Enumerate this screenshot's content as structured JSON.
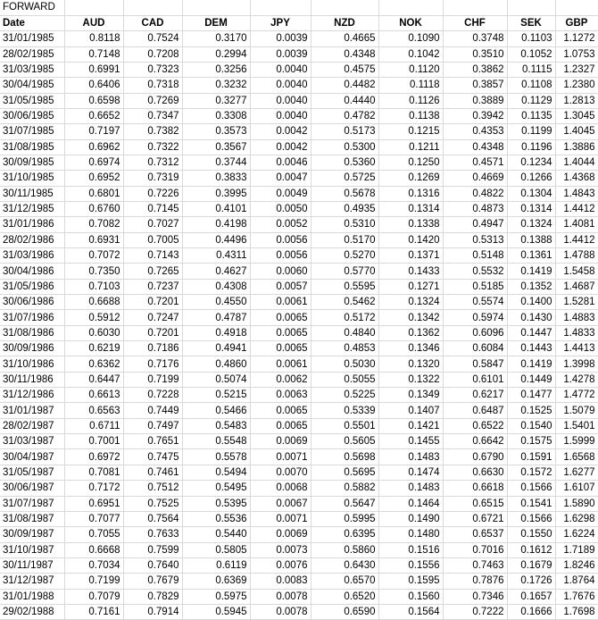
{
  "sheet": {
    "title_cell": "FORWARD",
    "headers": [
      "Date",
      "AUD",
      "CAD",
      "DEM",
      "JPY",
      "NZD",
      "NOK",
      "CHF",
      "SEK",
      "GBP"
    ],
    "rows": [
      [
        "31/01/1985",
        "0.8118",
        "0.7524",
        "0.3170",
        "0.0039",
        "0.4665",
        "0.1090",
        "0.3748",
        "0.1103",
        "1.1272"
      ],
      [
        "28/02/1985",
        "0.7148",
        "0.7208",
        "0.2994",
        "0.0039",
        "0.4348",
        "0.1042",
        "0.3510",
        "0.1052",
        "1.0753"
      ],
      [
        "31/03/1985",
        "0.6991",
        "0.7323",
        "0.3256",
        "0.0040",
        "0.4575",
        "0.1120",
        "0.3862",
        "0.1115",
        "1.2327"
      ],
      [
        "30/04/1985",
        "0.6406",
        "0.7318",
        "0.3232",
        "0.0040",
        "0.4482",
        "0.1118",
        "0.3857",
        "0.1108",
        "1.2380"
      ],
      [
        "31/05/1985",
        "0.6598",
        "0.7269",
        "0.3277",
        "0.0040",
        "0.4440",
        "0.1126",
        "0.3889",
        "0.1129",
        "1.2813"
      ],
      [
        "30/06/1985",
        "0.6652",
        "0.7347",
        "0.3308",
        "0.0040",
        "0.4782",
        "0.1138",
        "0.3942",
        "0.1135",
        "1.3045"
      ],
      [
        "31/07/1985",
        "0.7197",
        "0.7382",
        "0.3573",
        "0.0042",
        "0.5173",
        "0.1215",
        "0.4353",
        "0.1199",
        "1.4045"
      ],
      [
        "31/08/1985",
        "0.6962",
        "0.7322",
        "0.3567",
        "0.0042",
        "0.5300",
        "0.1211",
        "0.4348",
        "0.1196",
        "1.3886"
      ],
      [
        "30/09/1985",
        "0.6974",
        "0.7312",
        "0.3744",
        "0.0046",
        "0.5360",
        "0.1250",
        "0.4571",
        "0.1234",
        "1.4044"
      ],
      [
        "31/10/1985",
        "0.6952",
        "0.7319",
        "0.3833",
        "0.0047",
        "0.5725",
        "0.1269",
        "0.4669",
        "0.1266",
        "1.4368"
      ],
      [
        "30/11/1985",
        "0.6801",
        "0.7226",
        "0.3995",
        "0.0049",
        "0.5678",
        "0.1316",
        "0.4822",
        "0.1304",
        "1.4843"
      ],
      [
        "31/12/1985",
        "0.6760",
        "0.7145",
        "0.4101",
        "0.0050",
        "0.4935",
        "0.1314",
        "0.4873",
        "0.1314",
        "1.4412"
      ],
      [
        "31/01/1986",
        "0.7082",
        "0.7027",
        "0.4198",
        "0.0052",
        "0.5310",
        "0.1338",
        "0.4947",
        "0.1324",
        "1.4081"
      ],
      [
        "28/02/1986",
        "0.6931",
        "0.7005",
        "0.4496",
        "0.0056",
        "0.5170",
        "0.1420",
        "0.5313",
        "0.1388",
        "1.4412"
      ],
      [
        "31/03/1986",
        "0.7072",
        "0.7143",
        "0.4311",
        "0.0056",
        "0.5270",
        "0.1371",
        "0.5148",
        "0.1361",
        "1.4788"
      ],
      [
        "30/04/1986",
        "0.7350",
        "0.7265",
        "0.4627",
        "0.0060",
        "0.5770",
        "0.1433",
        "0.5532",
        "0.1419",
        "1.5458"
      ],
      [
        "31/05/1986",
        "0.7103",
        "0.7237",
        "0.4308",
        "0.0057",
        "0.5595",
        "0.1271",
        "0.5185",
        "0.1352",
        "1.4687"
      ],
      [
        "30/06/1986",
        "0.6688",
        "0.7201",
        "0.4550",
        "0.0061",
        "0.5462",
        "0.1324",
        "0.5574",
        "0.1400",
        "1.5281"
      ],
      [
        "31/07/1986",
        "0.5912",
        "0.7247",
        "0.4787",
        "0.0065",
        "0.5172",
        "0.1342",
        "0.5974",
        "0.1430",
        "1.4883"
      ],
      [
        "31/08/1986",
        "0.6030",
        "0.7201",
        "0.4918",
        "0.0065",
        "0.4840",
        "0.1362",
        "0.6096",
        "0.1447",
        "1.4833"
      ],
      [
        "30/09/1986",
        "0.6219",
        "0.7186",
        "0.4941",
        "0.0065",
        "0.4853",
        "0.1346",
        "0.6084",
        "0.1443",
        "1.4413"
      ],
      [
        "31/10/1986",
        "0.6362",
        "0.7176",
        "0.4860",
        "0.0061",
        "0.5030",
        "0.1320",
        "0.5847",
        "0.1419",
        "1.3998"
      ],
      [
        "30/11/1986",
        "0.6447",
        "0.7199",
        "0.5074",
        "0.0062",
        "0.5055",
        "0.1322",
        "0.6101",
        "0.1449",
        "1.4278"
      ],
      [
        "31/12/1986",
        "0.6613",
        "0.7228",
        "0.5215",
        "0.0063",
        "0.5225",
        "0.1349",
        "0.6217",
        "0.1477",
        "1.4772"
      ],
      [
        "31/01/1987",
        "0.6563",
        "0.7449",
        "0.5466",
        "0.0065",
        "0.5339",
        "0.1407",
        "0.6487",
        "0.1525",
        "1.5079"
      ],
      [
        "28/02/1987",
        "0.6711",
        "0.7497",
        "0.5483",
        "0.0065",
        "0.5501",
        "0.1421",
        "0.6522",
        "0.1540",
        "1.5401"
      ],
      [
        "31/03/1987",
        "0.7001",
        "0.7651",
        "0.5548",
        "0.0069",
        "0.5605",
        "0.1455",
        "0.6642",
        "0.1575",
        "1.5999"
      ],
      [
        "30/04/1987",
        "0.6972",
        "0.7475",
        "0.5578",
        "0.0071",
        "0.5698",
        "0.1483",
        "0.6790",
        "0.1591",
        "1.6568"
      ],
      [
        "31/05/1987",
        "0.7081",
        "0.7461",
        "0.5494",
        "0.0070",
        "0.5695",
        "0.1474",
        "0.6630",
        "0.1572",
        "1.6277"
      ],
      [
        "30/06/1987",
        "0.7172",
        "0.7512",
        "0.5495",
        "0.0068",
        "0.5882",
        "0.1483",
        "0.6618",
        "0.1566",
        "1.6107"
      ],
      [
        "31/07/1987",
        "0.6951",
        "0.7525",
        "0.5395",
        "0.0067",
        "0.5647",
        "0.1464",
        "0.6515",
        "0.1541",
        "1.5890"
      ],
      [
        "31/08/1987",
        "0.7077",
        "0.7564",
        "0.5536",
        "0.0071",
        "0.5995",
        "0.1490",
        "0.6721",
        "0.1566",
        "1.6298"
      ],
      [
        "30/09/1987",
        "0.7055",
        "0.7633",
        "0.5440",
        "0.0069",
        "0.6395",
        "0.1480",
        "0.6537",
        "0.1550",
        "1.6224"
      ],
      [
        "31/10/1987",
        "0.6668",
        "0.7599",
        "0.5805",
        "0.0073",
        "0.5860",
        "0.1516",
        "0.7016",
        "0.1612",
        "1.7189"
      ],
      [
        "30/11/1987",
        "0.7034",
        "0.7640",
        "0.6119",
        "0.0076",
        "0.6430",
        "0.1556",
        "0.7463",
        "0.1679",
        "1.8246"
      ],
      [
        "31/12/1987",
        "0.7199",
        "0.7679",
        "0.6369",
        "0.0083",
        "0.6570",
        "0.1595",
        "0.7876",
        "0.1726",
        "1.8764"
      ],
      [
        "31/01/1988",
        "0.7079",
        "0.7829",
        "0.5975",
        "0.0078",
        "0.6520",
        "0.1560",
        "0.7346",
        "0.1657",
        "1.7676"
      ],
      [
        "29/02/1988",
        "0.7161",
        "0.7914",
        "0.5945",
        "0.0078",
        "0.6590",
        "0.1564",
        "0.7222",
        "0.1666",
        "1.7698"
      ]
    ]
  }
}
